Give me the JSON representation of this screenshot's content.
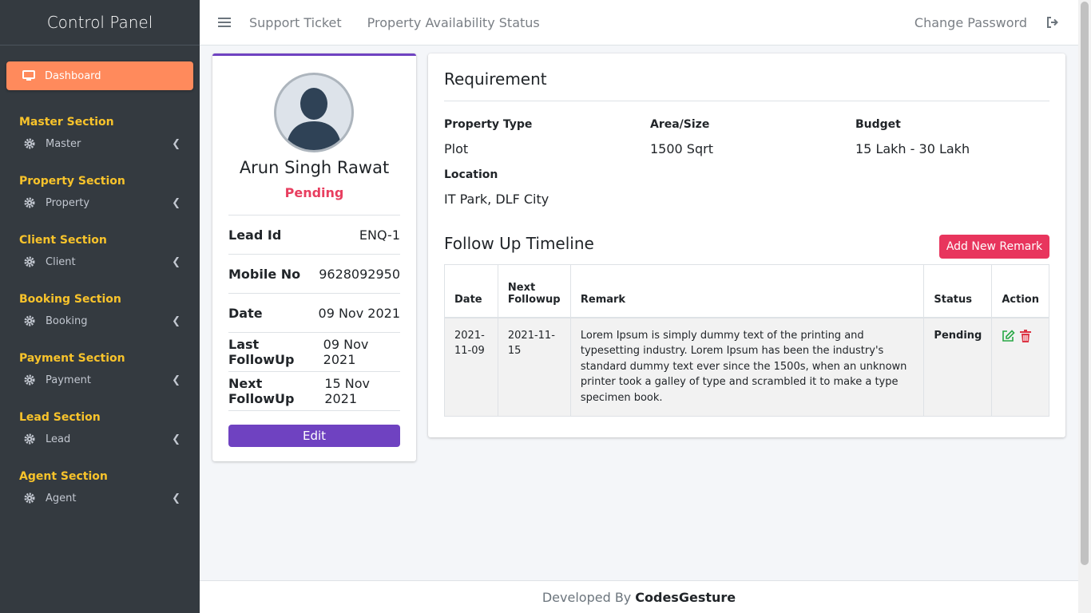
{
  "sidebar": {
    "brand": "Control Panel",
    "dashboard": {
      "label": "Dashboard",
      "icon": "monitor-icon",
      "color": "#ff8a5c"
    },
    "sections": [
      {
        "header": "Master Section",
        "item": "Master"
      },
      {
        "header": "Property Section",
        "item": "Property"
      },
      {
        "header": "Client Section",
        "item": "Client"
      },
      {
        "header": "Booking Section",
        "item": "Booking"
      },
      {
        "header": "Payment Section",
        "item": "Payment"
      },
      {
        "header": "Lead Section",
        "item": "Lead"
      },
      {
        "header": "Agent Section",
        "item": "Agent"
      }
    ],
    "item_icon": "gear-icon",
    "header_color": "#f8c32b"
  },
  "topbar": {
    "links": [
      "Support Ticket",
      "Property Availability Status"
    ],
    "change_password": "Change Password"
  },
  "profile": {
    "name": "Arun Singh Rawat",
    "status": "Pending",
    "rows": [
      {
        "key": "Lead Id",
        "value": "ENQ-1"
      },
      {
        "key": "Mobile No",
        "value": "9628092950"
      },
      {
        "key": "Date",
        "value": "09 Nov 2021"
      },
      {
        "key": "Last FollowUp",
        "value": "09 Nov 2021"
      },
      {
        "key": "Next FollowUp",
        "value": "15 Nov 2021"
      }
    ],
    "edit_label": "Edit"
  },
  "requirement": {
    "title": "Requirement",
    "fields": {
      "property_type": {
        "label": "Property Type",
        "value": "Plot"
      },
      "area": {
        "label": "Area/Size",
        "value": "1500 Sqrt"
      },
      "budget": {
        "label": "Budget",
        "value": "15 Lakh - 30 Lakh"
      },
      "location": {
        "label": "Location",
        "value": "IT Park, DLF City"
      }
    }
  },
  "followup": {
    "title": "Follow Up Timeline",
    "add_label": "Add New Remark",
    "columns": [
      "Date",
      "Next Followup",
      "Remark",
      "Status",
      "Action"
    ],
    "rows": [
      {
        "date": "2021-11-09",
        "next": "2021-11-15",
        "remark": "Lorem Ipsum is simply dummy text of the printing and typesetting industry. Lorem Ipsum has been the industry's standard dummy text ever since the 1500s, when an unknown printer took a galley of type and scrambled it to make a type specimen book.",
        "status": "Pending"
      }
    ]
  },
  "footer": {
    "prefix": "Developed By",
    "brand": "CodesGesture"
  }
}
